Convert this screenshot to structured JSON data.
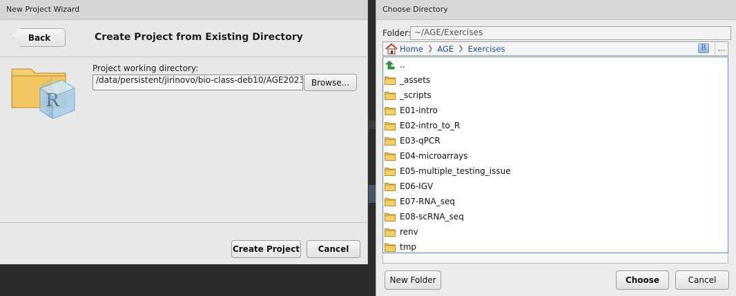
{
  "wizard": {
    "window_title": "New Project Wizard",
    "back_label": "Back",
    "heading": "Create Project from Existing Directory",
    "working_dir_label": "Project working directory:",
    "working_dir_value": "/data/persistent/jirinovo/bio-class-deb10/AGE2023",
    "browse_label": "Browse...",
    "create_label": "Create Project",
    "cancel_label": "Cancel"
  },
  "chooser": {
    "window_title": "Choose Directory",
    "folder_label": "Folder:",
    "folder_value": "~/AGE/Exercises",
    "breadcrumbs": [
      "Home",
      "AGE",
      "Exercises"
    ],
    "more_label": "...",
    "r_logo_letter": "R",
    "files": [
      {
        "name": "..",
        "icon": "up-arrow-icon"
      },
      {
        "name": "_assets",
        "icon": "folder-icon"
      },
      {
        "name": "_scripts",
        "icon": "folder-icon"
      },
      {
        "name": "E01-intro",
        "icon": "folder-icon"
      },
      {
        "name": "E02-intro_to_R",
        "icon": "folder-icon"
      },
      {
        "name": "E03-qPCR",
        "icon": "folder-icon"
      },
      {
        "name": "E04-microarrays",
        "icon": "folder-icon"
      },
      {
        "name": "E05-multiple_testing_issue",
        "icon": "folder-icon"
      },
      {
        "name": "E06-IGV",
        "icon": "folder-icon"
      },
      {
        "name": "E07-RNA_seq",
        "icon": "folder-icon"
      },
      {
        "name": "E08-scRNA_seq",
        "icon": "folder-icon"
      },
      {
        "name": "renv",
        "icon": "folder-icon"
      },
      {
        "name": "tmp",
        "icon": "folder-icon"
      }
    ],
    "new_folder_label": "New Folder",
    "choose_label": "Choose",
    "cancel_label": "Cancel"
  },
  "colors": {
    "link": "#1e4c9a",
    "selection_border": "#4a90d9",
    "folder": "#f2c14e"
  }
}
